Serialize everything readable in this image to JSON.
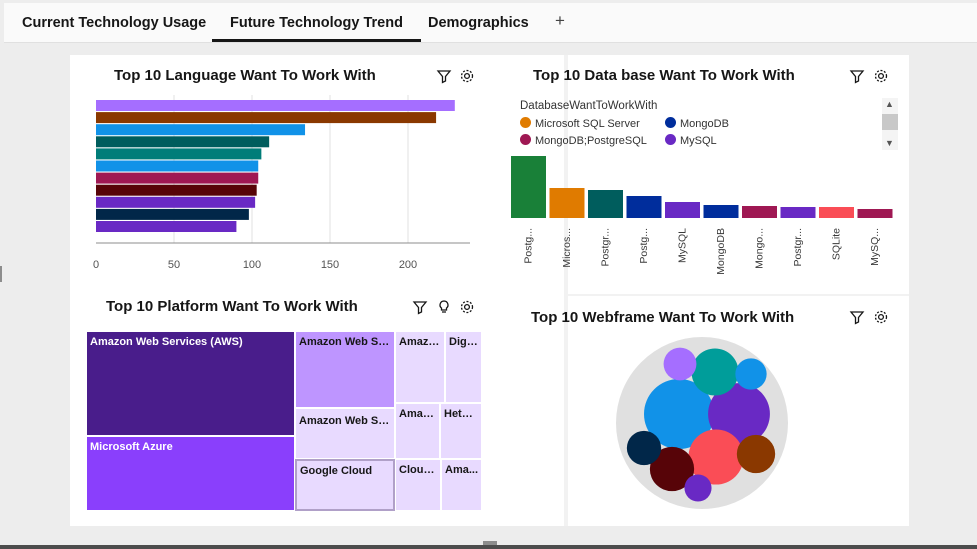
{
  "tabs": [
    {
      "label": "Current Technology Usage"
    },
    {
      "label": "Future Technology Trend"
    },
    {
      "label": "Demographics"
    }
  ],
  "add_tab_label": "+",
  "language_panel": {
    "title": "Top 10 Language Want To Work With",
    "icons": [
      "filter-icon",
      "settings-icon"
    ],
    "chart_data": {
      "type": "bar",
      "orientation": "horizontal",
      "values": [
        230,
        218,
        134,
        111,
        106,
        104,
        104,
        103,
        102,
        98,
        90
      ],
      "colors": [
        "#a56eff",
        "#8a3800",
        "#1192e8",
        "#005d5d",
        "#007d79",
        "#1192e8",
        "#9f1853",
        "#570408",
        "#6929c4",
        "#012749",
        "#6929c4"
      ],
      "xticks": [
        0,
        50,
        100,
        150,
        200
      ],
      "xlim": [
        0,
        240
      ],
      "grid": true
    }
  },
  "database_panel": {
    "title": "Top 10 Data base Want To Work With",
    "icons": [
      "filter-icon",
      "settings-icon"
    ],
    "legend": {
      "title": "DatabaseWantToWorkWith",
      "items": [
        {
          "label": "Microsoft SQL Server",
          "color": "#e07b00"
        },
        {
          "label": "MongoDB",
          "color": "#002d9c"
        },
        {
          "label": "MongoDB;PostgreSQL",
          "color": "#9f1853"
        },
        {
          "label": "MySQL",
          "color": "#6929c4"
        }
      ]
    },
    "chart_data": {
      "type": "bar",
      "categories": [
        "Postg...",
        "Micros...",
        "Postgr...",
        "Postg...",
        "MySQL",
        "MongoDB",
        "Mongo...",
        "Postgr...",
        "SQLite",
        "MySQ..."
      ],
      "values": [
        62,
        30,
        28,
        22,
        16,
        13,
        12,
        11,
        11,
        9
      ],
      "colors": [
        "#198038",
        "#e07b00",
        "#005d5d",
        "#002d9c",
        "#6929c4",
        "#002d9c",
        "#9f1853",
        "#6929c4",
        "#fa4d56",
        "#9f1853"
      ]
    }
  },
  "platform_panel": {
    "title": "Top 10 Platform Want To Work With",
    "icons": [
      "filter-icon",
      "lightbulb-icon",
      "settings-icon"
    ],
    "chart_data": {
      "type": "treemap",
      "cells": [
        {
          "label": "Amazon Web Services (AWS)",
          "color": "#491d8b",
          "text_color": "#ffffff"
        },
        {
          "label": "Microsoft Azure",
          "color": "#8a3ffc",
          "text_color": "#ffffff"
        },
        {
          "label": "Amazon Web Ser...",
          "color": "#be95ff",
          "text_color": "#161616"
        },
        {
          "label": "Amazon Web Ser...",
          "color": "#e8daff",
          "text_color": "#161616"
        },
        {
          "label": "Google Cloud",
          "color": "#e8daff",
          "text_color": "#161616"
        },
        {
          "label": "Amazo...",
          "color": "#e8daff",
          "text_color": "#161616"
        },
        {
          "label": "Digi...",
          "color": "#e8daff",
          "text_color": "#161616"
        },
        {
          "label": "Amaz...",
          "color": "#e8daff",
          "text_color": "#161616"
        },
        {
          "label": "Hetzn...",
          "color": "#e8daff",
          "text_color": "#161616"
        },
        {
          "label": "Cloudf...",
          "color": "#e8daff",
          "text_color": "#161616"
        },
        {
          "label": "Ama...",
          "color": "#e8daff",
          "text_color": "#161616"
        }
      ]
    }
  },
  "webframe_panel": {
    "title": "Top 10 Webframe Want To Work With",
    "icons": [
      "filter-icon",
      "settings-icon"
    ],
    "chart_data": {
      "type": "packed-bubble",
      "bubbles": [
        {
          "color": "#1192e8",
          "value": 100
        },
        {
          "color": "#6929c4",
          "value": 78
        },
        {
          "color": "#fa4d56",
          "value": 62
        },
        {
          "color": "#009d9a",
          "value": 45
        },
        {
          "color": "#570408",
          "value": 40
        },
        {
          "color": "#8a3800",
          "value": 30
        },
        {
          "color": "#012749",
          "value": 24
        },
        {
          "color": "#a56eff",
          "value": 22
        },
        {
          "color": "#1192e8",
          "value": 20
        },
        {
          "color": "#6929c4",
          "value": 15
        }
      ]
    }
  }
}
